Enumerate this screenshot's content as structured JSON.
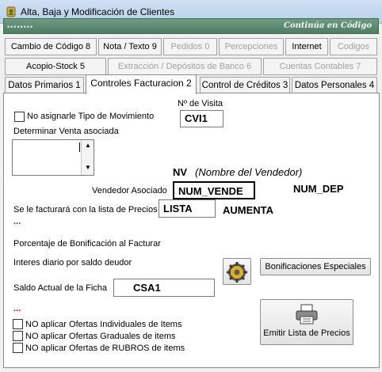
{
  "window": {
    "title": "Alta, Baja y Modificación de Clientes",
    "app_icon": "app-icon"
  },
  "banner": {
    "dots": "••••••••",
    "text": "Continúa en Código"
  },
  "toolbar_row1": [
    {
      "label": "Cambio de Código 8",
      "enabled": true
    },
    {
      "label": "Nota / Texto 9",
      "enabled": true
    },
    {
      "label": "Pedidos 0",
      "enabled": false
    },
    {
      "label": "Percepciones",
      "enabled": false
    },
    {
      "label": "Internet",
      "enabled": true
    },
    {
      "label": "Codigos",
      "enabled": false
    }
  ],
  "toolbar_row2": [
    {
      "label": "Acopio-Stock 5",
      "enabled": true
    },
    {
      "label": "Extracción / Depósitos de Banco 6",
      "enabled": false
    },
    {
      "label": "Cuentas Contables 7",
      "enabled": false
    }
  ],
  "tabs": [
    {
      "label": "Datos Primarios 1",
      "selected": false
    },
    {
      "label": "Controles Facturacion 2",
      "selected": true
    },
    {
      "label": "Control de Créditos 3",
      "selected": false
    },
    {
      "label": "Datos Personales 4",
      "selected": false
    }
  ],
  "form": {
    "visita_label": "Nº de Visita",
    "visita_value": "CVI1",
    "no_tipo_mov_label": "No asignarle Tipo de Movimiento",
    "no_tipo_mov_checked": false,
    "venta_asociada_label": "Determinar Venta asociada",
    "nv_label": "NV",
    "nv_desc": "(Nombre del Vendedor)",
    "vendedor_label": "Vendedor Asociado",
    "vendedor_value": "NUM_VENDE",
    "num_dep": "NUM_DEP",
    "lista_label": "Se le facturará con la lista de Precios",
    "lista_value": "LISTA",
    "aumenta": "AUMENTA",
    "dots1": "...",
    "bonif_label": "Porcentaje de Bonificación al Facturar",
    "interes_label": "Interes diario por saldo deudor",
    "bonif_especiales_button": "Bonificaciones Especiales",
    "saldo_label": "Saldo Actual de la Ficha",
    "saldo_value": "CSA1",
    "dots2": "...",
    "ofertas": [
      {
        "label": "NO aplicar Ofertas Individuales de Items",
        "checked": false
      },
      {
        "label": "NO aplicar Ofertas Graduales de items",
        "checked": false
      },
      {
        "label": "NO aplicar Ofertas de RUBROS de items",
        "checked": false
      }
    ],
    "emitir_button": "Emitir Lista de Precios"
  }
}
